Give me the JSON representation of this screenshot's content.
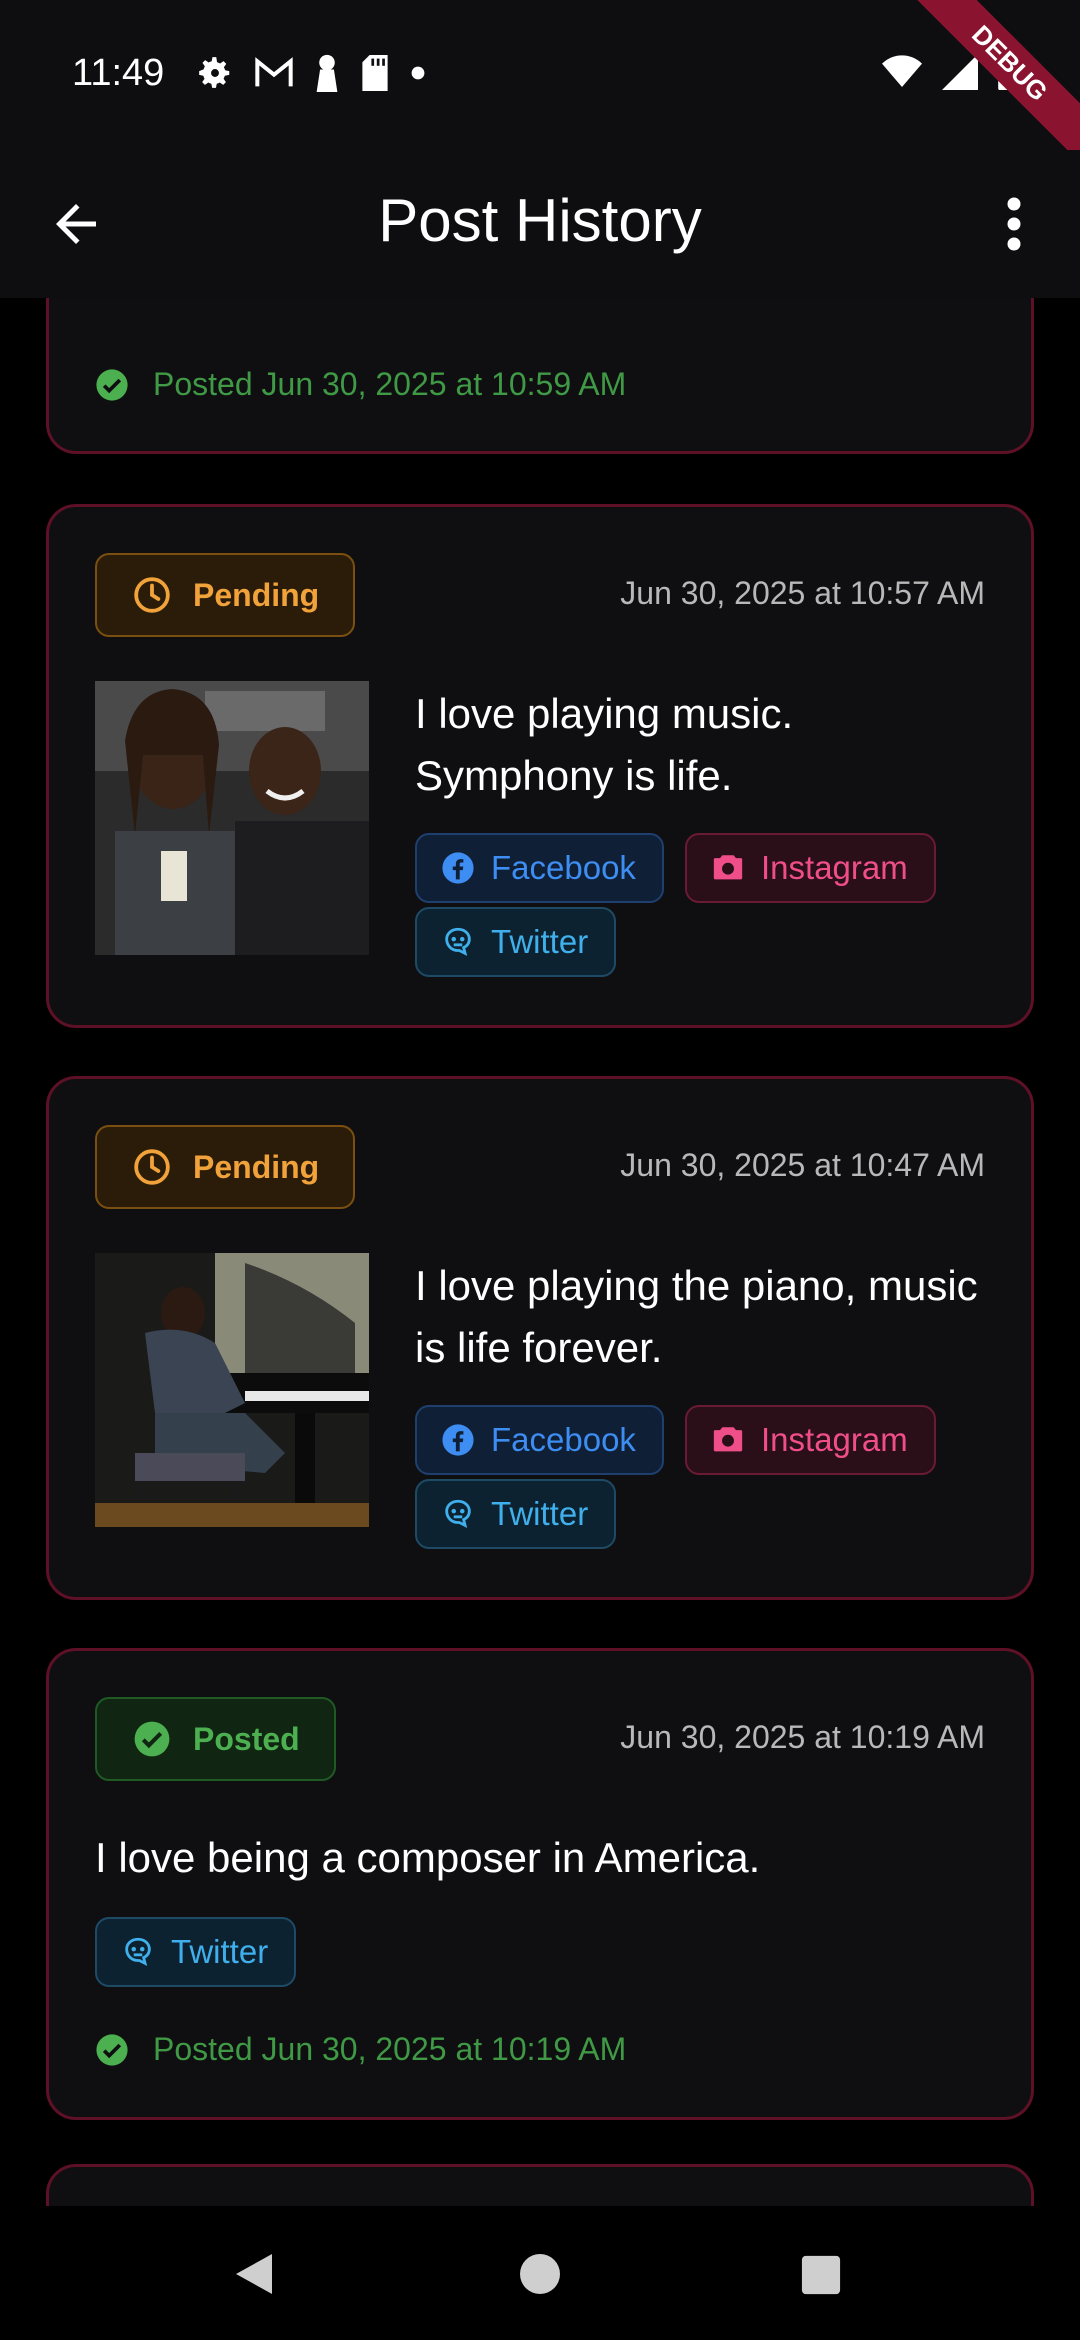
{
  "status_bar": {
    "time": "11:49",
    "left_icons": [
      "gear-icon",
      "gmail-icon",
      "keyhole-icon",
      "sd-card-icon",
      "dot-icon"
    ],
    "right_icons": [
      "wifi-icon",
      "signal-icon",
      "battery-icon"
    ],
    "debug_label": "DEBUG"
  },
  "app_bar": {
    "title": "Post History",
    "back_icon": "arrow-back-icon",
    "menu_icon": "more-vert-icon"
  },
  "colors": {
    "pending": "#f2a23a",
    "posted": "#4caf50",
    "facebook": "#3d8df2",
    "instagram": "#f04e88",
    "twitter": "#3fb0ec",
    "card_border": "#5e1026"
  },
  "posts": [
    {
      "status_line": "Posted Jun 30, 2025 at 10:59 AM"
    },
    {
      "status": "Pending",
      "date": "Jun 30, 2025 at 10:57 AM",
      "text": "I love playing music. Symphony is life.",
      "platforms": [
        "Facebook",
        "Instagram",
        "Twitter"
      ]
    },
    {
      "status": "Pending",
      "date": "Jun 30, 2025 at 10:47 AM",
      "text": "I love playing the piano, music is life forever.",
      "platforms": [
        "Facebook",
        "Instagram",
        "Twitter"
      ]
    },
    {
      "status": "Posted",
      "date": "Jun 30, 2025 at 10:19 AM",
      "text": "I love being a composer in America.",
      "platforms": [
        "Twitter"
      ],
      "status_line": "Posted Jun 30, 2025 at 10:19 AM"
    }
  ],
  "nav_bar": {
    "back": "nav-back-icon",
    "home": "nav-home-icon",
    "recents": "nav-recents-icon"
  }
}
